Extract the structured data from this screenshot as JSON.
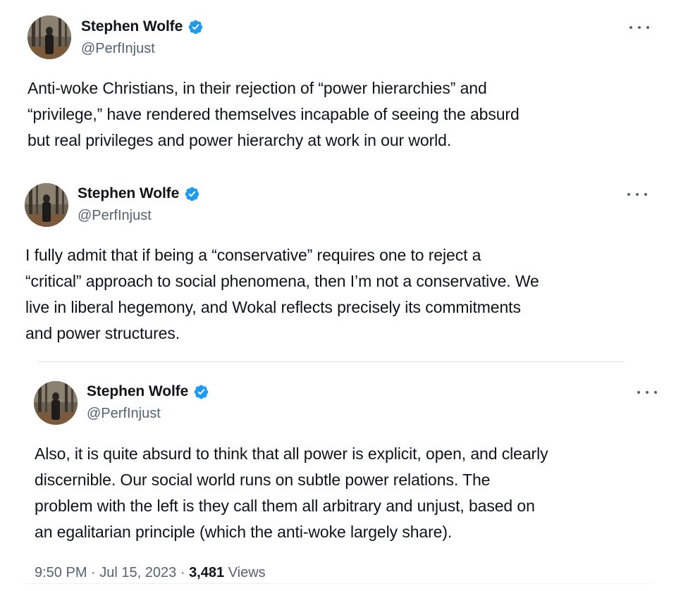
{
  "colors": {
    "text": "#0f1419",
    "secondary": "#536471",
    "verified": "#1d9bf0",
    "divider": "#dfe3e6"
  },
  "tweets": [
    {
      "author": {
        "name": "Stephen Wolfe",
        "handle": "@PerfInjust",
        "verified": true
      },
      "text": "Anti-woke Christians, in their rejection of “power hierarchies” and\n“privilege,” have rendered themselves incapable of seeing the absurd\nbut real privileges and power hierarchy at work in our world."
    },
    {
      "author": {
        "name": "Stephen Wolfe",
        "handle": "@PerfInjust",
        "verified": true
      },
      "text": "I fully admit that if being a “conservative” requires one to reject a\n“critical” approach to social phenomena, then I’m not a conservative. We\nlive in liberal hegemony, and Wokal reflects precisely its commitments\nand power structures."
    },
    {
      "author": {
        "name": "Stephen Wolfe",
        "handle": "@PerfInjust",
        "verified": true
      },
      "text": "Also, it is quite absurd to think that all power is explicit, open, and clearly\ndiscernible. Our social world runs on subtle power relations. The\nproblem with the left is they call them all arbitrary and unjust, based on\nan egalitarian principle (which the anti-woke largely share).",
      "timestamp": {
        "time": "9:50 PM",
        "separator": "·",
        "date": "Jul 15, 2023",
        "views_count": "3,481",
        "views_label": "Views"
      }
    }
  ]
}
